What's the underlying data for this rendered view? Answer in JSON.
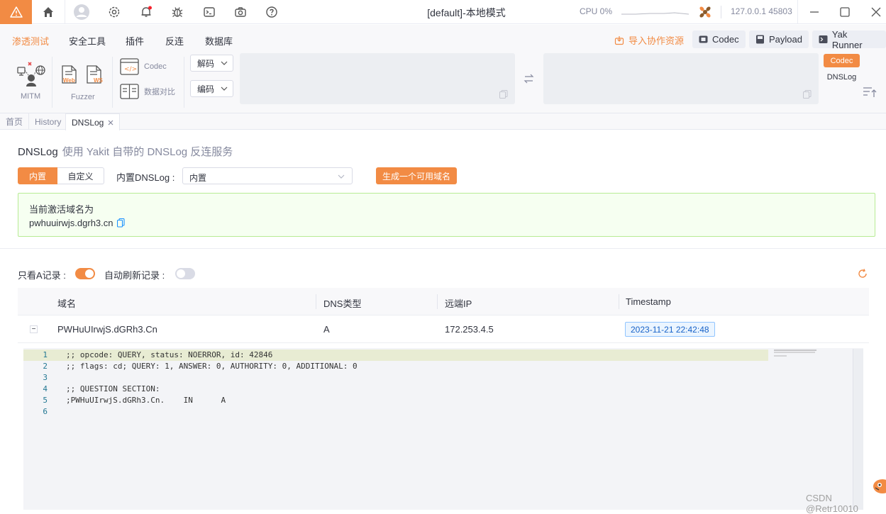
{
  "titlebar": {
    "window_title": "[default]-本地模式",
    "cpu_label": "CPU 0%",
    "engine_addr": "127.0.0.1 45803"
  },
  "menu": {
    "items": [
      "渗透测试",
      "安全工具",
      "插件",
      "反连",
      "数据库"
    ],
    "import_label": "导入协作资源",
    "codec_btn": "Codec",
    "payload_btn": "Payload",
    "yakrunner_btn": "Yak Runner"
  },
  "toolbar": {
    "mitm": "MITM",
    "fuzzer": "Fuzzer",
    "fuzzer_web": "Web",
    "fuzzer_ws": "WS",
    "codec": "Codec",
    "compare": "数据对比",
    "decode": "解码",
    "encode": "编码",
    "side_codec": "Codec",
    "side_dnslog": "DNSLog"
  },
  "tabs": [
    "首页",
    "History",
    "DNSLog"
  ],
  "page": {
    "title": "DNSLog",
    "subtitle": "使用 Yakit 自带的 DNSLog 反连服务",
    "seg_builtin": "内置",
    "seg_custom": "自定义",
    "builtin_label": "内置DNSLog :",
    "builtin_value": "内置",
    "generate_btn": "生成一个可用域名",
    "active_label": "当前激活域名为",
    "active_domain": "pwhuuirwjs.dgrh3.cn",
    "only_a_label": "只看A记录 :",
    "auto_refresh_label": "自动刷新记录 :"
  },
  "switches": {
    "only_a": true,
    "auto_refresh": false
  },
  "table": {
    "headers": [
      "域名",
      "DNS类型",
      "远端IP",
      "Timestamp"
    ],
    "rows": [
      {
        "expand": "−",
        "domain": "PWHuUIrwjS.dGRh3.Cn",
        "type": "A",
        "ip": "172.253.4.5",
        "timestamp": "2023-11-21 22:42:48"
      }
    ]
  },
  "editor": {
    "lines": [
      {
        "n": "1",
        "text": ";; opcode: QUERY, status: NOERROR, id: 42846"
      },
      {
        "n": "2",
        "text": ";; flags: cd; QUERY: 1, ANSWER: 0, AUTHORITY: 0, ADDITIONAL: 0"
      },
      {
        "n": "3",
        "text": ""
      },
      {
        "n": "4",
        "text": ";; QUESTION SECTION:"
      },
      {
        "n": "5",
        "text": ";PWHuUIrwjS.dGRh3.Cn.\t IN\t A"
      },
      {
        "n": "6",
        "text": ""
      }
    ]
  },
  "watermark": "CSDN @Retr10010",
  "colors": {
    "accent": "#f28b44",
    "success_bg": "#f6fff1",
    "success_border": "#b8eb95",
    "link_blue": "#1890ff"
  }
}
